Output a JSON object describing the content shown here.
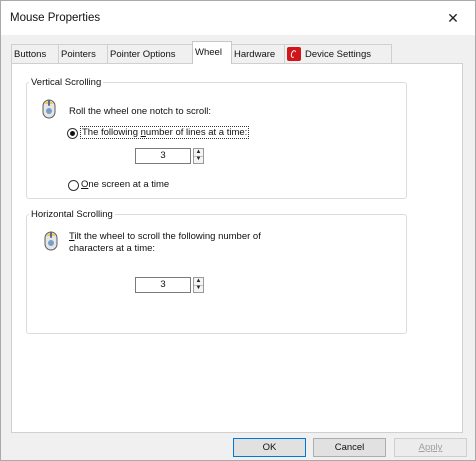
{
  "window": {
    "title": "Mouse Properties",
    "close_glyph": "✕"
  },
  "tabs": [
    {
      "label": "Buttons"
    },
    {
      "label": "Pointers"
    },
    {
      "label": "Pointer Options"
    },
    {
      "label": "Wheel",
      "active": true
    },
    {
      "label": "Hardware"
    },
    {
      "label": "Device Settings",
      "icon": "device-settings-icon"
    }
  ],
  "vertical": {
    "legend": "Vertical Scrolling",
    "icon": "mouse-wheel-icon",
    "instruction": "Roll the wheel one notch to scroll:",
    "option_lines": {
      "pre": "The following ",
      "accel": "n",
      "post": "umber of lines at a time:",
      "checked": true
    },
    "lines_value": "3",
    "option_screen": {
      "accel": "O",
      "post": "ne screen at a time",
      "checked": false
    }
  },
  "horizontal": {
    "legend": "Horizontal Scrolling",
    "icon": "mouse-wheel-icon",
    "instruction_accel": "T",
    "instruction_line1": "ilt the wheel to scroll the following number of",
    "instruction_line2": "characters at a time:",
    "chars_value": "3"
  },
  "buttons": {
    "ok": "OK",
    "cancel": "Cancel",
    "apply": "Apply"
  },
  "spinner": {
    "up": "▲",
    "down": "▼"
  }
}
